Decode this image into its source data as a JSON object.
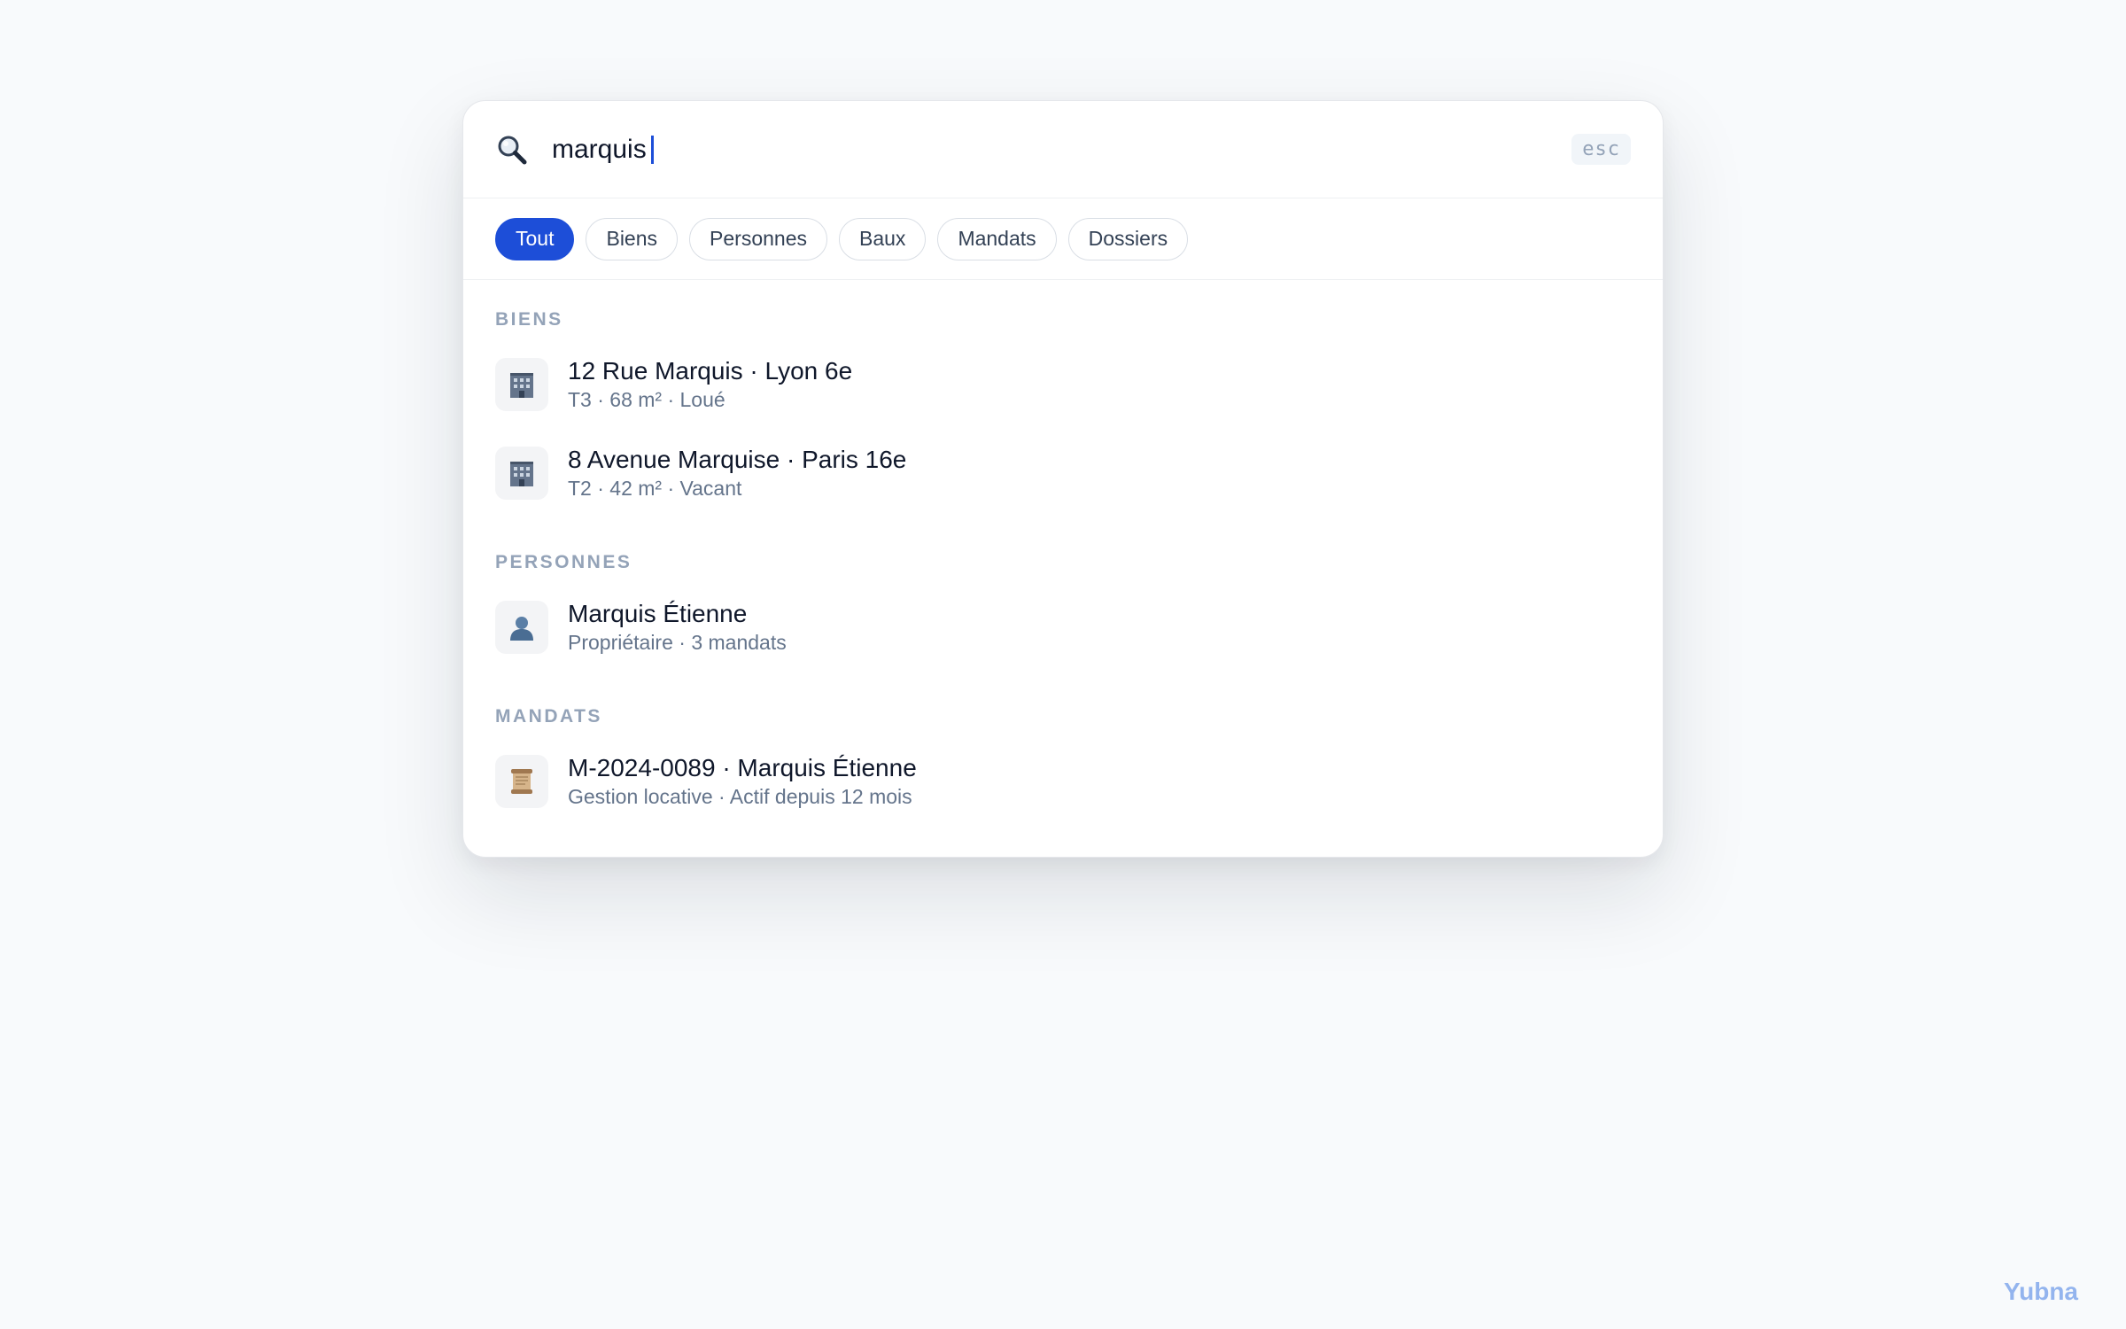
{
  "search": {
    "query": "marquis",
    "esc_label": "esc"
  },
  "filters": [
    {
      "label": "Tout",
      "active": true
    },
    {
      "label": "Biens",
      "active": false
    },
    {
      "label": "Personnes",
      "active": false
    },
    {
      "label": "Baux",
      "active": false
    },
    {
      "label": "Mandats",
      "active": false
    },
    {
      "label": "Dossiers",
      "active": false
    }
  ],
  "groups": {
    "biens": {
      "label": "BIENS",
      "items": [
        {
          "icon": "building-icon",
          "title": "12 Rue Marquis · Lyon 6e",
          "subtitle": "T3 · 68 m² · Loué"
        },
        {
          "icon": "building-icon",
          "title": "8 Avenue Marquise · Paris 16e",
          "subtitle": "T2 · 42 m² · Vacant"
        }
      ]
    },
    "personnes": {
      "label": "PERSONNES",
      "items": [
        {
          "icon": "person-icon",
          "title": "Marquis Étienne",
          "subtitle": "Propriétaire · 3 mandats"
        }
      ]
    },
    "mandats": {
      "label": "MANDATS",
      "items": [
        {
          "icon": "scroll-icon",
          "title": "M-2024-0089 · Marquis Étienne",
          "subtitle": "Gestion locative · Actif depuis 12 mois"
        }
      ]
    }
  },
  "brand": {
    "name": "Yubna"
  },
  "colors": {
    "accent": "#1d4ed8",
    "muted": "#94a3b8",
    "brand": "#93b4ee"
  }
}
